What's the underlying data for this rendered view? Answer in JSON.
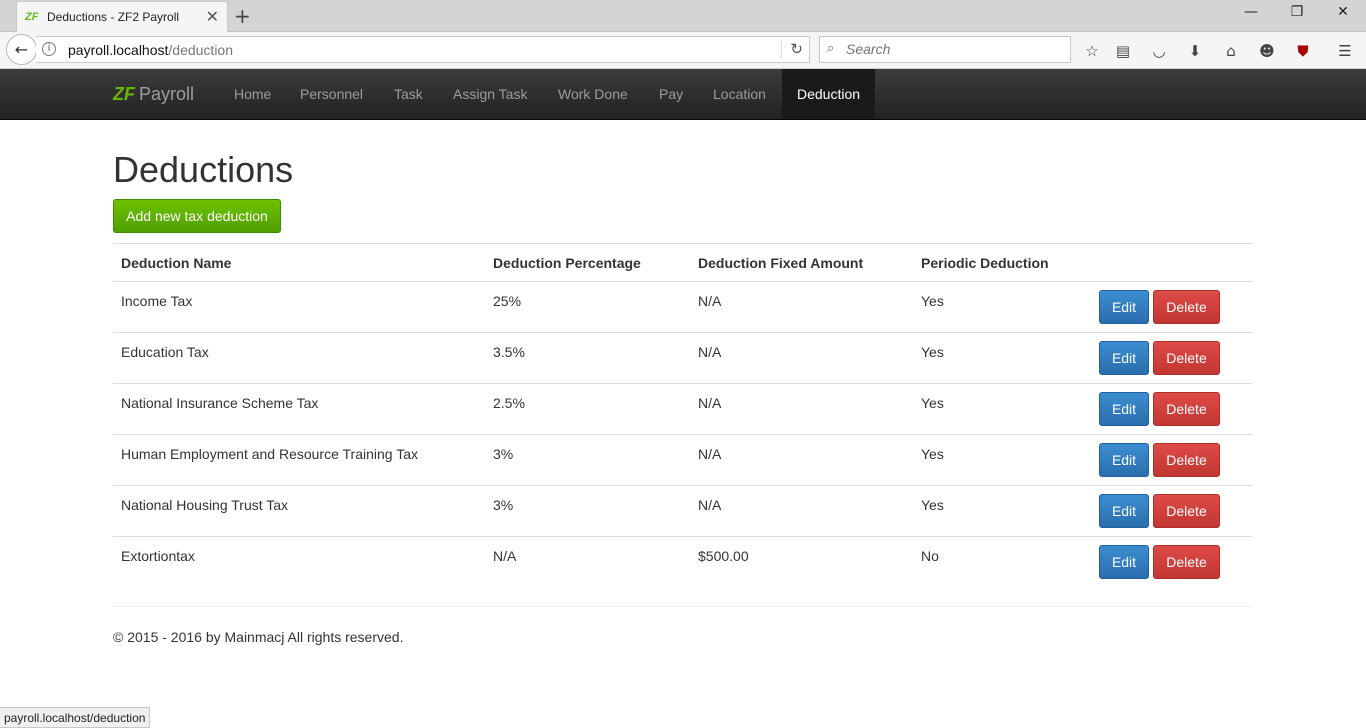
{
  "browser": {
    "tab_title": "Deductions - ZF2 Payroll",
    "tab_favicon": "ZF",
    "new_tab": "+",
    "url_host": "payroll.localhost",
    "url_path": "/deduction",
    "search_placeholder": "Search",
    "status_url": "payroll.localhost/deduction",
    "icons": [
      "back-arrow-icon",
      "info-icon",
      "reload-icon",
      "search-icon",
      "bookmark-star-icon",
      "reader-list-icon",
      "pocket-icon",
      "download-icon",
      "home-icon",
      "emoji-icon",
      "ublock-icon",
      "menu-icon"
    ]
  },
  "nav": {
    "brand_logo": "ZF",
    "brand_text": "Payroll",
    "items": [
      {
        "label": "Home"
      },
      {
        "label": "Personnel"
      },
      {
        "label": "Task"
      },
      {
        "label": "Assign Task"
      },
      {
        "label": "Work Done"
      },
      {
        "label": "Pay"
      },
      {
        "label": "Location"
      },
      {
        "label": "Deduction",
        "active": true
      }
    ]
  },
  "page": {
    "title": "Deductions",
    "add_button": "Add new tax deduction"
  },
  "table": {
    "headers": [
      "Deduction Name",
      "Deduction Percentage",
      "Deduction Fixed Amount",
      "Periodic Deduction"
    ],
    "edit_label": "Edit",
    "delete_label": "Delete",
    "rows": [
      {
        "name": "Income Tax",
        "percentage": "25%",
        "fixed": "N/A",
        "periodic": "Yes"
      },
      {
        "name": "Education Tax",
        "percentage": "3.5%",
        "fixed": "N/A",
        "periodic": "Yes"
      },
      {
        "name": "National Insurance Scheme Tax",
        "percentage": "2.5%",
        "fixed": "N/A",
        "periodic": "Yes"
      },
      {
        "name": "Human Employment and Resource Training Tax",
        "percentage": "3%",
        "fixed": "N/A",
        "periodic": "Yes"
      },
      {
        "name": "National Housing Trust Tax",
        "percentage": "3%",
        "fixed": "N/A",
        "periodic": "Yes"
      },
      {
        "name": "Extortiontax",
        "percentage": "N/A",
        "fixed": "$500.00",
        "periodic": "No"
      }
    ]
  },
  "footer": {
    "text": "© 2015 - 2016 by Mainmacj All rights reserved."
  },
  "colors": {
    "nav_bg": "#222222",
    "brand_green": "#68b604",
    "add_button": "#5cb200",
    "edit_button": "#337ab7",
    "delete_button": "#d9534f"
  }
}
